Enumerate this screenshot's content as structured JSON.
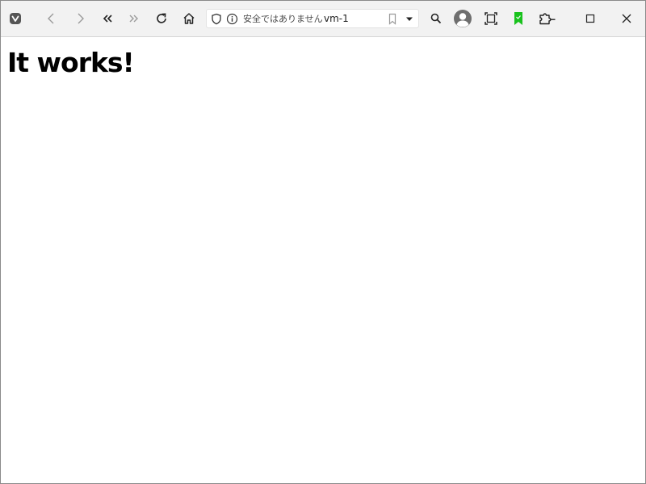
{
  "browser": {
    "toolbar": {
      "menu_icon": "vivaldi-menu-icon",
      "back_icon": "chevron-left-icon",
      "forward_icon": "chevron-right-icon",
      "rewind_icon": "double-chevron-left-icon",
      "fast_forward_icon": "double-chevron-right-icon",
      "reload_icon": "reload-icon",
      "home_icon": "home-icon",
      "search_icon": "search-icon",
      "profile_icon": "profile-avatar-icon",
      "capture_icon": "capture-icon",
      "bookmark_panel_icon": "green-bookmark-icon",
      "extensions_icon": "puzzle-icon",
      "maximize_icon": "maximize-icon",
      "close_icon": "close-icon"
    },
    "address_bar": {
      "security_label": "安全ではありません",
      "url": "vm-1"
    },
    "colors": {
      "toolbar_bg": "#f2f2f2",
      "accent_green": "#19c21d",
      "icon_dark": "#333333"
    }
  },
  "page": {
    "heading": "It works!"
  }
}
